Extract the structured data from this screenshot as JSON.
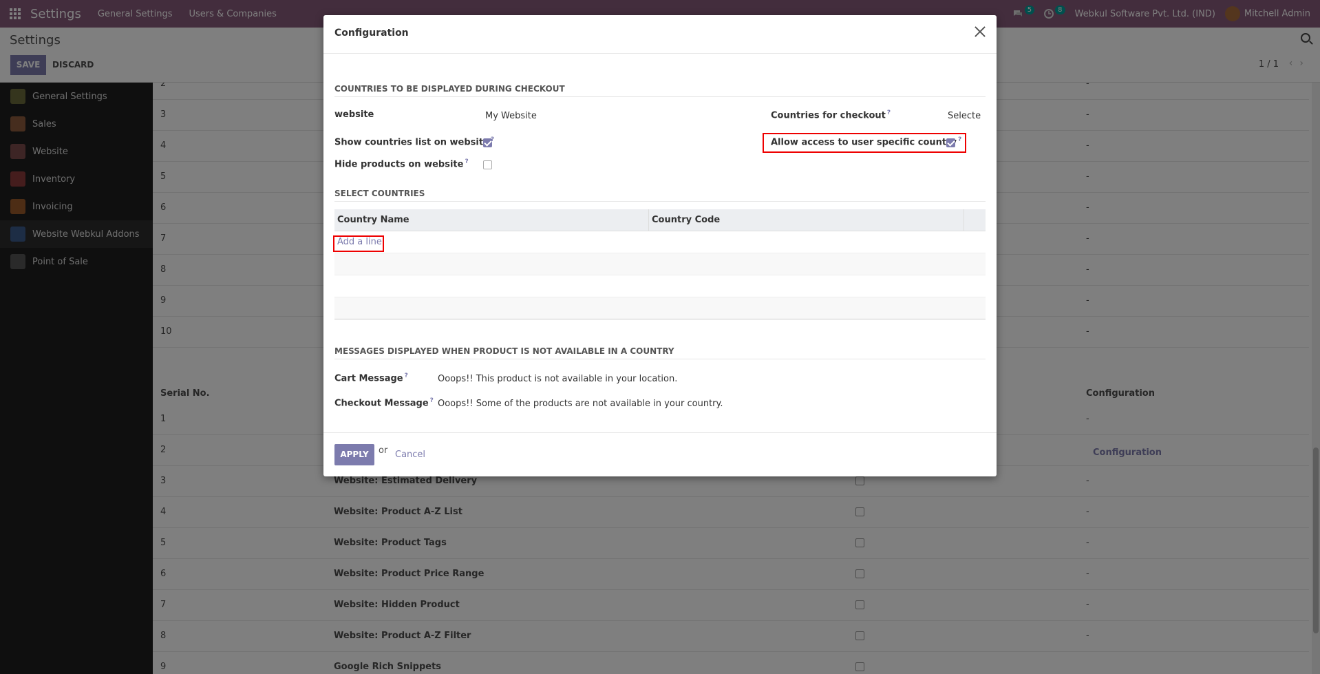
{
  "navbar": {
    "brand": "Settings",
    "links": [
      "General Settings",
      "Users & Companies"
    ],
    "messages_count": "5",
    "activities_count": "8",
    "company": "Webkul Software Pvt. Ltd. (IND)",
    "user": "Mitchell Admin"
  },
  "control": {
    "title": "Settings",
    "save_label": "SAVE",
    "discard_label": "DISCARD",
    "pager": "1 / 1"
  },
  "sidebar": {
    "items": [
      {
        "label": "General Settings",
        "color": "#6b6b3a"
      },
      {
        "label": "Sales",
        "color": "#8c5a3c"
      },
      {
        "label": "Website",
        "color": "#7a4a4a"
      },
      {
        "label": "Inventory",
        "color": "#8b3b3b"
      },
      {
        "label": "Invoicing",
        "color": "#9a5a2a"
      },
      {
        "label": "Website Webkul Addons",
        "color": "#3a5a8a"
      },
      {
        "label": "Point of Sale",
        "color": "#555555"
      }
    ]
  },
  "background_list": {
    "upper_rows": [
      {
        "sn": "2",
        "config": "-"
      },
      {
        "sn": "3",
        "config": "-"
      },
      {
        "sn": "4",
        "config": "-"
      },
      {
        "sn": "5",
        "config": "-"
      },
      {
        "sn": "6",
        "config": "-"
      },
      {
        "sn": "7",
        "config": "-"
      },
      {
        "sn": "8",
        "config": "-"
      },
      {
        "sn": "9",
        "config": "-"
      },
      {
        "sn": "10",
        "config": "-"
      }
    ],
    "headers": {
      "serial": "Serial No.",
      "config": "Configuration"
    },
    "lower_rows": [
      {
        "sn": "1",
        "name": "",
        "config": "-"
      },
      {
        "sn": "2",
        "name": "",
        "config": "Configuration"
      },
      {
        "sn": "3",
        "name": "Website: Estimated Delivery",
        "config": "-"
      },
      {
        "sn": "4",
        "name": "Website: Product A-Z List",
        "config": "-"
      },
      {
        "sn": "5",
        "name": "Website: Product Tags",
        "config": "-"
      },
      {
        "sn": "6",
        "name": "Website: Product Price Range",
        "config": "-"
      },
      {
        "sn": "7",
        "name": "Website: Hidden Product",
        "config": "-"
      },
      {
        "sn": "8",
        "name": "Website: Product A-Z Filter",
        "config": "-"
      },
      {
        "sn": "9",
        "name": "Google Rich Snippets",
        "config": ""
      }
    ]
  },
  "modal": {
    "title": "Configuration",
    "section1_title": "COUNTRIES TO BE DISPLAYED DURING CHECKOUT",
    "website_label": "website",
    "website_value": "My Website",
    "countries_checkout_label": "Countries for checkout",
    "countries_checkout_value": "Selecte",
    "show_countries_label": "Show countries list on website",
    "show_countries_checked": true,
    "allow_access_label": "Allow access to user specific country",
    "allow_access_checked": true,
    "hide_products_label": "Hide products on website",
    "hide_products_checked": false,
    "help_mark": "?",
    "section2_title": "SELECT COUNTRIES",
    "col_country_name": "Country Name",
    "col_country_code": "Country Code",
    "add_line": "Add a line",
    "section3_title": "MESSAGES DISPLAYED WHEN PRODUCT IS NOT AVAILABLE IN A COUNTRY",
    "cart_message_label": "Cart Message",
    "cart_message_value": "Ooops!! This product is not available in your location.",
    "checkout_message_label": "Checkout Message",
    "checkout_message_value": "Ooops!! Some of the products are not available in your country.",
    "apply_label": "APPLY",
    "or_text": "or",
    "cancel_label": "Cancel"
  },
  "colors": {
    "brand": "#875a7b",
    "primary": "#7c7bad",
    "highlight": "#ff0000"
  }
}
